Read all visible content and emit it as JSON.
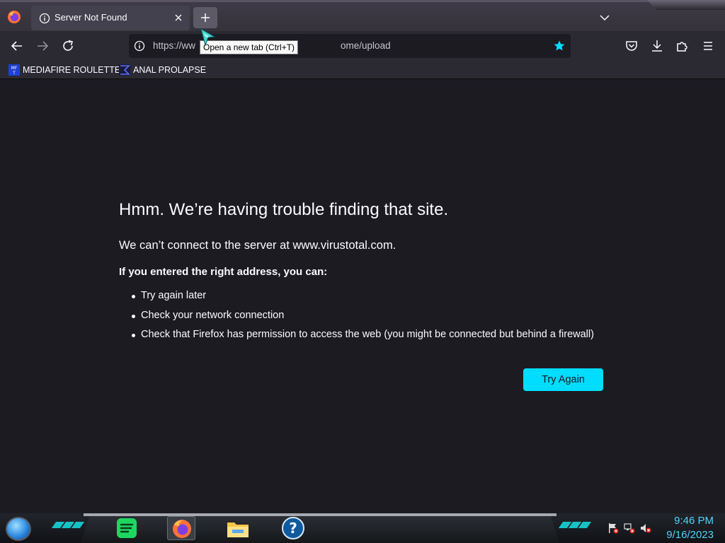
{
  "browser": {
    "tab": {
      "title": "Server Not Found"
    },
    "tooltip": "Open a new tab (Ctrl+T)",
    "url": {
      "prefix": "https://ww",
      "suffix": "ome/upload"
    }
  },
  "bookmarks": [
    {
      "label": "MEDIAFIRE ROULETTER",
      "icon": "mf-icon"
    },
    {
      "label": "ANAL PROLAPSE",
      "icon": "sigma-icon"
    }
  ],
  "error": {
    "title": "Hmm. We’re having trouble finding that site.",
    "subtitle": "We can’t connect to the server at www.virustotal.com.",
    "hint": "If you entered the right address, you can:",
    "tips": [
      "Try again later",
      "Check your network connection",
      "Check that Firefox has permission to access the web (you might be connected but behind a firewall)"
    ],
    "button": "Try Again"
  },
  "taskbar": {
    "apps": [
      "spotify-icon",
      "firefox-icon",
      "file-explorer-icon",
      "help-icon"
    ],
    "clock": {
      "time": "9:46 PM",
      "date": "9/16/2023"
    }
  },
  "colors": {
    "accent": "#00ddff",
    "star": "#00ddff",
    "clock": "#4fd3ff"
  }
}
